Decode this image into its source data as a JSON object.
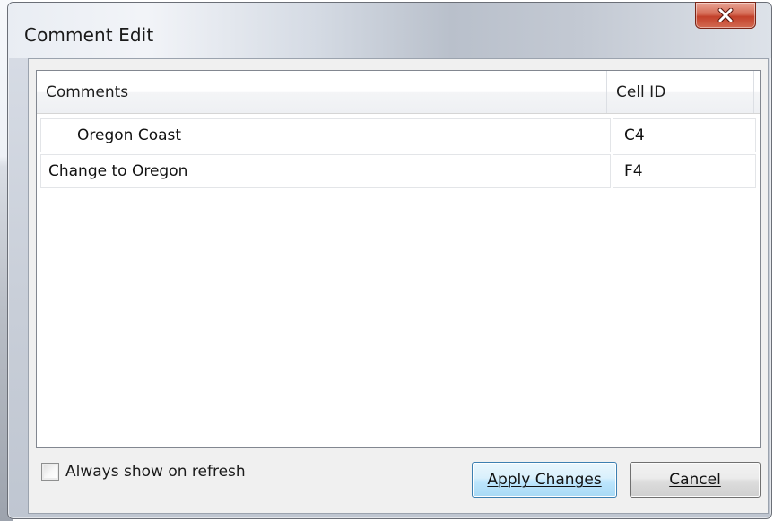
{
  "window": {
    "title": "Comment Edit",
    "close_icon": "close-icon"
  },
  "list": {
    "columns": [
      {
        "label": "Comments"
      },
      {
        "label": "Cell ID"
      }
    ],
    "rows": [
      {
        "comment": "Oregon Coast",
        "cell_id": "C4",
        "indented": true
      },
      {
        "comment": "Change to Oregon",
        "cell_id": "F4",
        "indented": false
      }
    ]
  },
  "footer": {
    "checkbox_label": "Always show on refresh",
    "checkbox_checked": false
  },
  "buttons": {
    "apply_label": "Apply Changes",
    "cancel_label": "Cancel"
  },
  "colors": {
    "close_button": "#c8442e",
    "default_button_border": "#3c7fb1"
  }
}
